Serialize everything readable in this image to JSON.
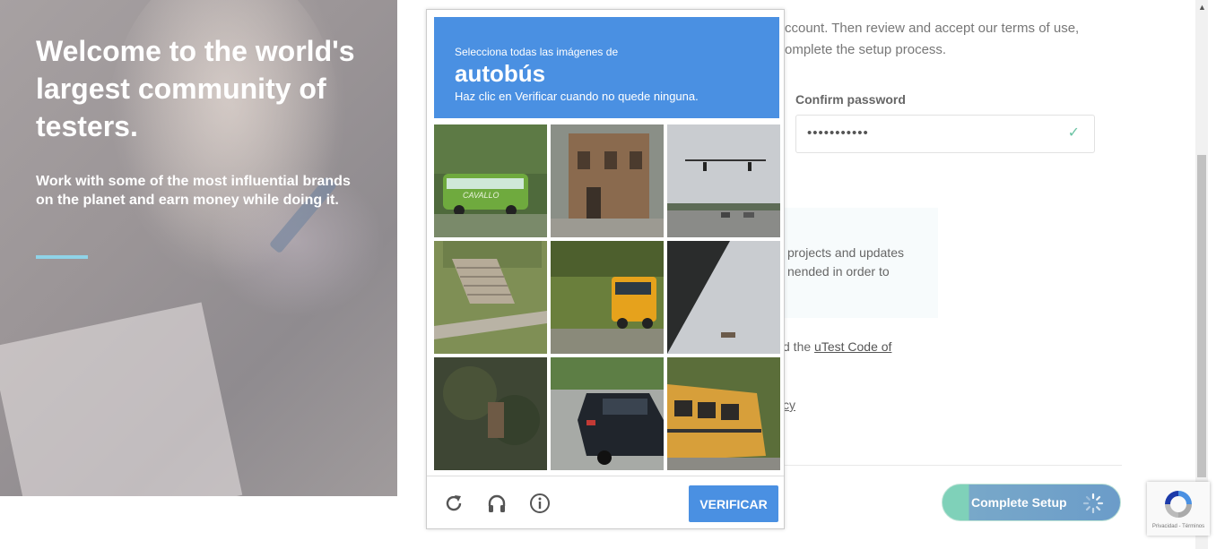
{
  "hero": {
    "title": "Welcome to the world's largest community of testers.",
    "subtitle": "Work with some of the most influential brands on the planet and earn money while doing it."
  },
  "form": {
    "intro_line1": "ccount. Then review and accept our terms of use,",
    "intro_line2": "omplete the setup process.",
    "confirm_password_label": "Confirm password",
    "confirm_password_value": "•••••••••••",
    "info_line1": " projects and updates",
    "info_line2": "nended in order to",
    "code_prefix": "d the ",
    "code_link": "uTest Code of",
    "privacy_fragment": "cy",
    "complete_button": "Complete Setup"
  },
  "captcha": {
    "instruction_small": "Selecciona todas las imágenes de",
    "target_word": "autobús",
    "instruction_hint": "Haz clic en Verificar cuando no quede ninguna.",
    "verify_button": "VERIFICAR",
    "tiles": [
      {
        "name": "tile-green-bus",
        "label": "CAVALLO"
      },
      {
        "name": "tile-brick-building"
      },
      {
        "name": "tile-street-traffic-lights"
      },
      {
        "name": "tile-stairs-grass"
      },
      {
        "name": "tile-yellow-school-bus"
      },
      {
        "name": "tile-dark-diagonal-roof"
      },
      {
        "name": "tile-dark-foliage"
      },
      {
        "name": "tile-black-car"
      },
      {
        "name": "tile-school-bus-rear"
      }
    ]
  },
  "recaptcha_badge": {
    "terms": "Privacidad - Términos"
  },
  "colors": {
    "captcha_blue": "#4a90e2",
    "accent_teal": "#7fd1b9",
    "hero_accent_line": "#8fd3e8"
  }
}
